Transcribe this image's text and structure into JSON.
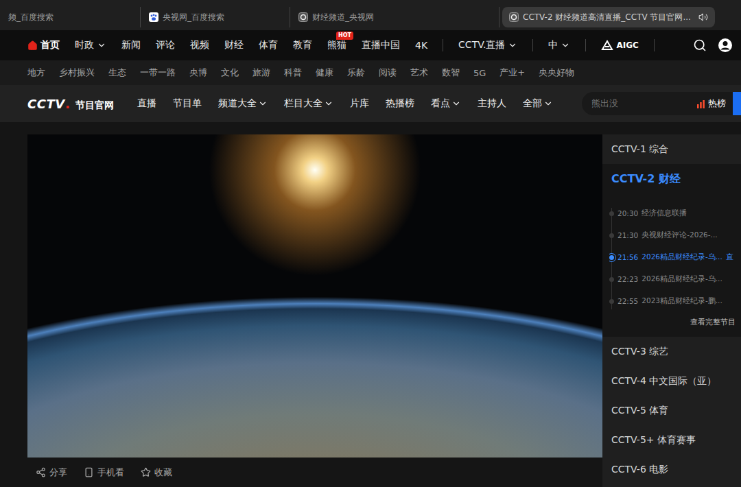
{
  "browser": {
    "tabs": [
      {
        "label": "频_百度搜索",
        "selected": false,
        "favicon": "none"
      },
      {
        "label": "央视网_百度搜索",
        "selected": false,
        "favicon": "baidu"
      },
      {
        "label": "财经频道_央视网",
        "selected": false,
        "favicon": "cctv"
      },
      {
        "label": "CCTV-2 财经频道高清直播_CCTV 节目官网...",
        "selected": true,
        "favicon": "cctv"
      }
    ]
  },
  "main_nav": {
    "items": [
      {
        "label": "首页",
        "selected": true,
        "dropdown": false
      },
      {
        "label": "时政",
        "selected": false,
        "dropdown": true
      },
      {
        "label": "新闻",
        "selected": false,
        "dropdown": false
      },
      {
        "label": "评论",
        "selected": false,
        "dropdown": false
      },
      {
        "label": "视频",
        "selected": false,
        "dropdown": false
      },
      {
        "label": "财经",
        "selected": false,
        "dropdown": false
      },
      {
        "label": "体育",
        "selected": false,
        "dropdown": false
      },
      {
        "label": "教育",
        "selected": false,
        "dropdown": false
      },
      {
        "label": "熊猫",
        "selected": false,
        "dropdown": false,
        "badge": "HOT"
      },
      {
        "label": "直播中国",
        "selected": false,
        "dropdown": false
      },
      {
        "label": "4K",
        "selected": false,
        "dropdown": false
      }
    ],
    "menus": [
      {
        "label": "CCTV.直播"
      },
      {
        "label": "中"
      }
    ],
    "aigc": "AIGC"
  },
  "sub_nav": {
    "items": [
      "地方",
      "乡村振兴",
      "生态",
      "一带一路",
      "央博",
      "文化",
      "旅游",
      "科普",
      "健康",
      "乐龄",
      "阅读",
      "艺术",
      "数智",
      "5G",
      "产业+",
      "央央好物"
    ]
  },
  "program_nav": {
    "logo": {
      "mark": "CCTV",
      "dot": ".",
      "title": "节目官网"
    },
    "items": [
      {
        "label": "直播",
        "dropdown": false
      },
      {
        "label": "节目单",
        "dropdown": false
      },
      {
        "label": "频道大全",
        "dropdown": true
      },
      {
        "label": "栏目大全",
        "dropdown": true
      },
      {
        "label": "片库",
        "dropdown": false
      },
      {
        "label": "热播榜",
        "dropdown": false
      },
      {
        "label": "看点",
        "dropdown": true
      },
      {
        "label": "主持人",
        "dropdown": false
      },
      {
        "label": "全部",
        "dropdown": true
      }
    ],
    "search": {
      "placeholder": "熊出没",
      "hot_label": "热榜"
    }
  },
  "sidebar": {
    "channels": [
      {
        "name": "CCTV-1 综合",
        "selected": false
      },
      {
        "name": "CCTV-2 财经",
        "selected": true
      },
      {
        "name": "CCTV-3 综艺",
        "selected": false
      },
      {
        "name": "CCTV-4 中文国际（亚）",
        "selected": false
      },
      {
        "name": "CCTV-5 体育",
        "selected": false
      },
      {
        "name": "CCTV-5+ 体育赛事",
        "selected": false
      },
      {
        "name": "CCTV-6 电影",
        "selected": false
      }
    ],
    "schedule": {
      "items": [
        {
          "time": "20:30",
          "title": "经济信息联播",
          "selected": false
        },
        {
          "time": "21:30",
          "title": "央视财经评论-2026-...",
          "selected": false
        },
        {
          "time": "21:56",
          "title": "2026精品财经纪录-乌...",
          "selected": true,
          "tag": "直"
        },
        {
          "time": "22:23",
          "title": "2026精品财经纪录-乌...",
          "selected": false
        },
        {
          "time": "22:55",
          "title": "2023精品财经纪录-鹏...",
          "selected": false
        }
      ],
      "more": "查看完整节目"
    }
  },
  "actions": [
    {
      "label": "分享",
      "kind": "share"
    },
    {
      "label": "手机看",
      "kind": "phone"
    },
    {
      "label": "收藏",
      "kind": "star"
    }
  ]
}
